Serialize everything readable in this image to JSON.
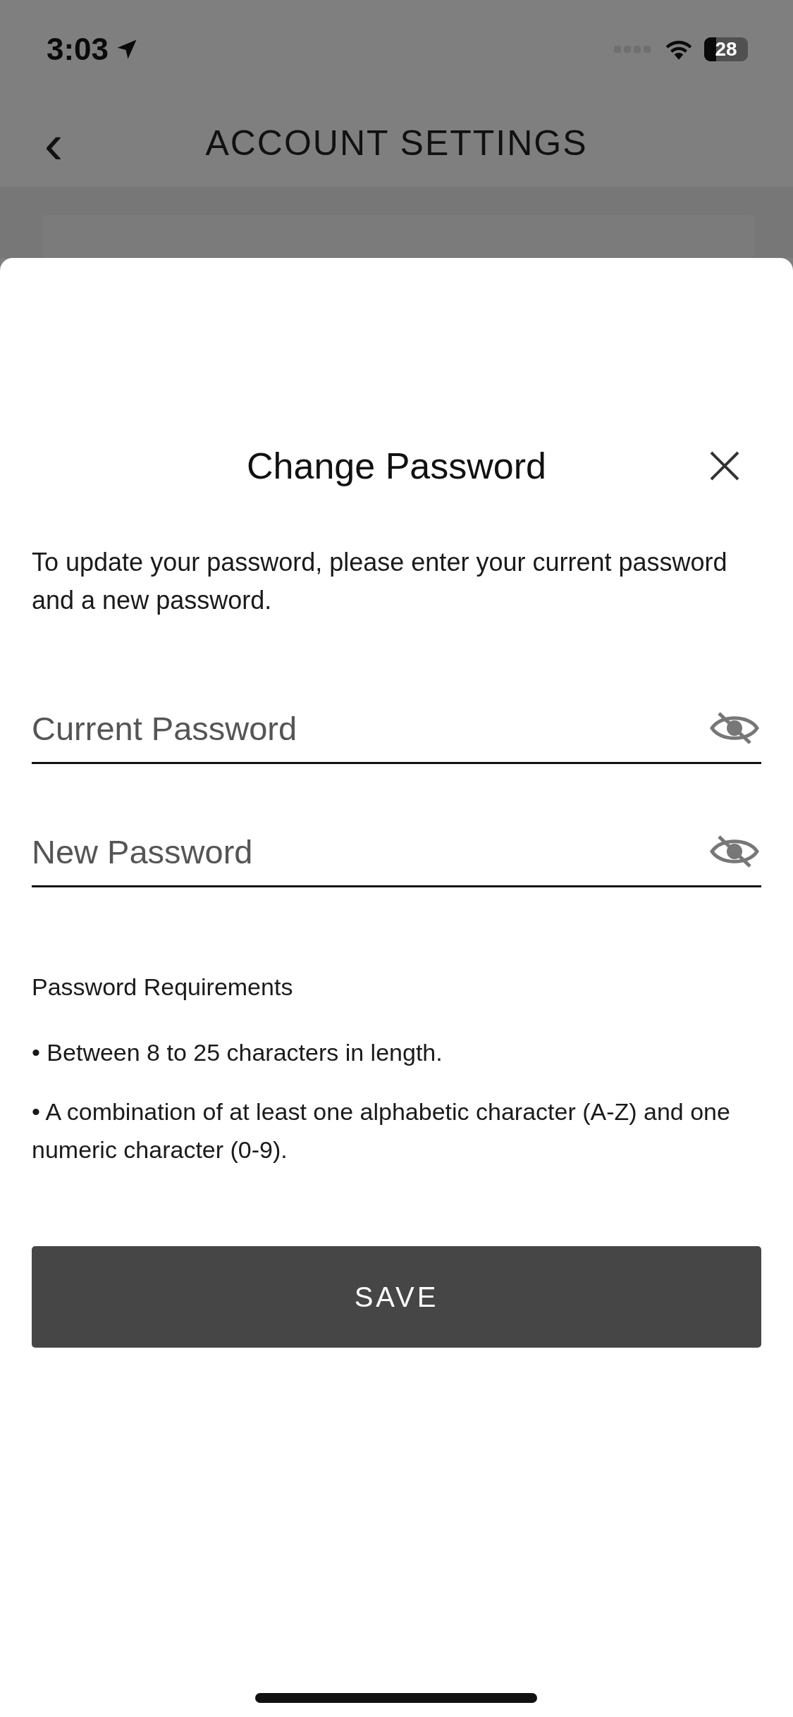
{
  "status_bar": {
    "time": "3:03",
    "battery": "28"
  },
  "header": {
    "title": "ACCOUNT SETTINGS",
    "back": "‹"
  },
  "sheet": {
    "title": "Change Password",
    "description": "To update your password, please enter your current password and a new password.",
    "fields": [
      {
        "placeholder": "Current Password",
        "revealed": false
      },
      {
        "placeholder": "New Password",
        "revealed": false
      }
    ],
    "requirements_title": "Password Requirements",
    "requirements": [
      "• Between 8 to 25 characters in length.",
      "• A combination of at least one alphabetic character (A-Z) and one numeric character (0-9)."
    ],
    "save_button": "SAVE"
  }
}
